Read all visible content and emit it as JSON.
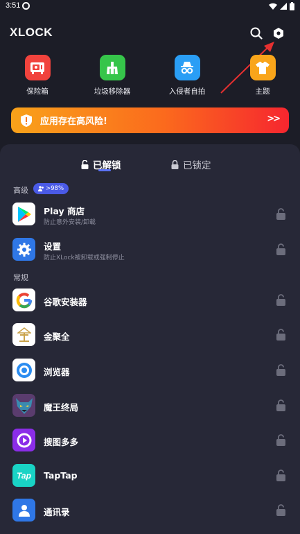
{
  "status": {
    "time": "3:51"
  },
  "header": {
    "logo": "XLOCK"
  },
  "features": [
    {
      "label": "保险箱",
      "icon": "vault-icon",
      "color": "#f1433d"
    },
    {
      "label": "垃圾移除器",
      "icon": "broom-icon",
      "color": "#36c54a"
    },
    {
      "label": "入侵者自拍",
      "icon": "intruder-icon",
      "color": "#2a9ef5"
    },
    {
      "label": "主题",
      "icon": "shirt-icon",
      "color": "#f9a51a"
    }
  ],
  "risk": {
    "text": "应用存在高风险!",
    "arrow": ">>"
  },
  "tabs": {
    "unlocked": "已解锁",
    "locked": "已锁定"
  },
  "sections": {
    "advanced": "高级",
    "advanced_badge": ">98%",
    "normal": "常规"
  },
  "advanced_apps": [
    {
      "name": "Play 商店",
      "desc": "防止意外安装/卸载"
    },
    {
      "name": "设置",
      "desc": "防止XLock被卸载或强制停止"
    }
  ],
  "normal_apps": [
    {
      "name": "谷歌安装器"
    },
    {
      "name": "金聚全"
    },
    {
      "name": "浏览器"
    },
    {
      "name": "魔王终局"
    },
    {
      "name": "搜图多多"
    },
    {
      "name": "TapTap",
      "icon_text": "Tap"
    },
    {
      "name": "通讯录"
    }
  ],
  "colors": {
    "accent": "#5b72f4",
    "panel": "#272837",
    "background": "#1c1d27"
  }
}
